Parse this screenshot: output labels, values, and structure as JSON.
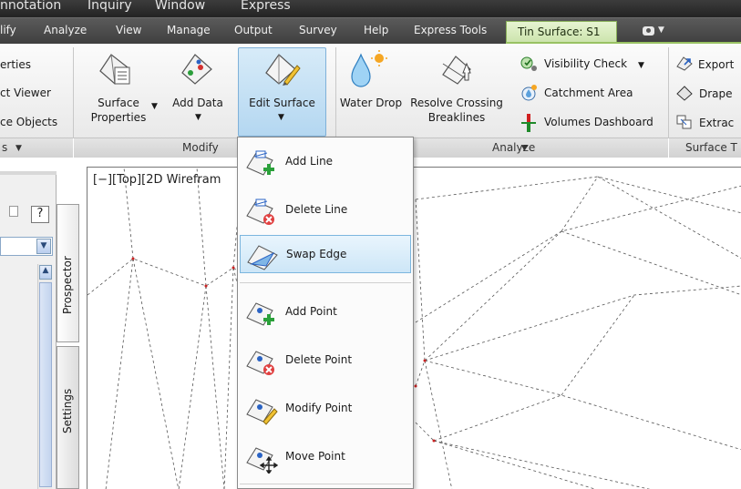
{
  "menubar": {
    "items": [
      "nnotation",
      "Inquiry",
      "Window",
      "Express"
    ]
  },
  "ribbon_tabs": {
    "items": [
      "lify",
      "Analyze",
      "View",
      "Manage",
      "Output",
      "Survey",
      "Help",
      "Express Tools"
    ],
    "contextual_tab": "Tin Surface: S1"
  },
  "panels": {
    "left": {
      "items": [
        "erties",
        "ct Viewer",
        "ce Objects"
      ],
      "footer": "s"
    },
    "modify": {
      "surface_properties": [
        "Surface",
        "Properties"
      ],
      "add_data": "Add Data",
      "edit_surface": "Edit Surface",
      "footer": "Modify"
    },
    "analyze": {
      "water_drop": "Water Drop",
      "resolve_crossing": [
        "Resolve Crossing",
        "Breaklines"
      ],
      "visibility_check": "Visibility Check",
      "catchment_area": "Catchment Area",
      "volumes_dashboard": "Volumes Dashboard",
      "footer": "Analyze"
    },
    "surface_tools": {
      "items": [
        "Export",
        "Drape",
        "Extrac"
      ],
      "footer": "Surface T"
    }
  },
  "edit_surface_menu": {
    "items": [
      {
        "label": "Add Line",
        "icon": "add-line-icon"
      },
      {
        "label": "Delete Line",
        "icon": "delete-line-icon"
      },
      {
        "label": "Swap Edge",
        "icon": "swap-edge-icon",
        "selected": true
      },
      {
        "label": "Add Point",
        "icon": "add-point-icon"
      },
      {
        "label": "Delete Point",
        "icon": "delete-point-icon"
      },
      {
        "label": "Modify Point",
        "icon": "modify-point-icon"
      },
      {
        "label": "Move Point",
        "icon": "move-point-icon"
      }
    ]
  },
  "toolspace": {
    "help_label": "?",
    "tabs": [
      "Prospector",
      "Settings"
    ]
  },
  "viewport": {
    "label": "[−][Top][2D Wirefram"
  },
  "colors": {
    "contextual_tab_bg": "#d6ebbb",
    "selected_button_bg": "#c4e0f5",
    "point_label": "#cc2222"
  }
}
